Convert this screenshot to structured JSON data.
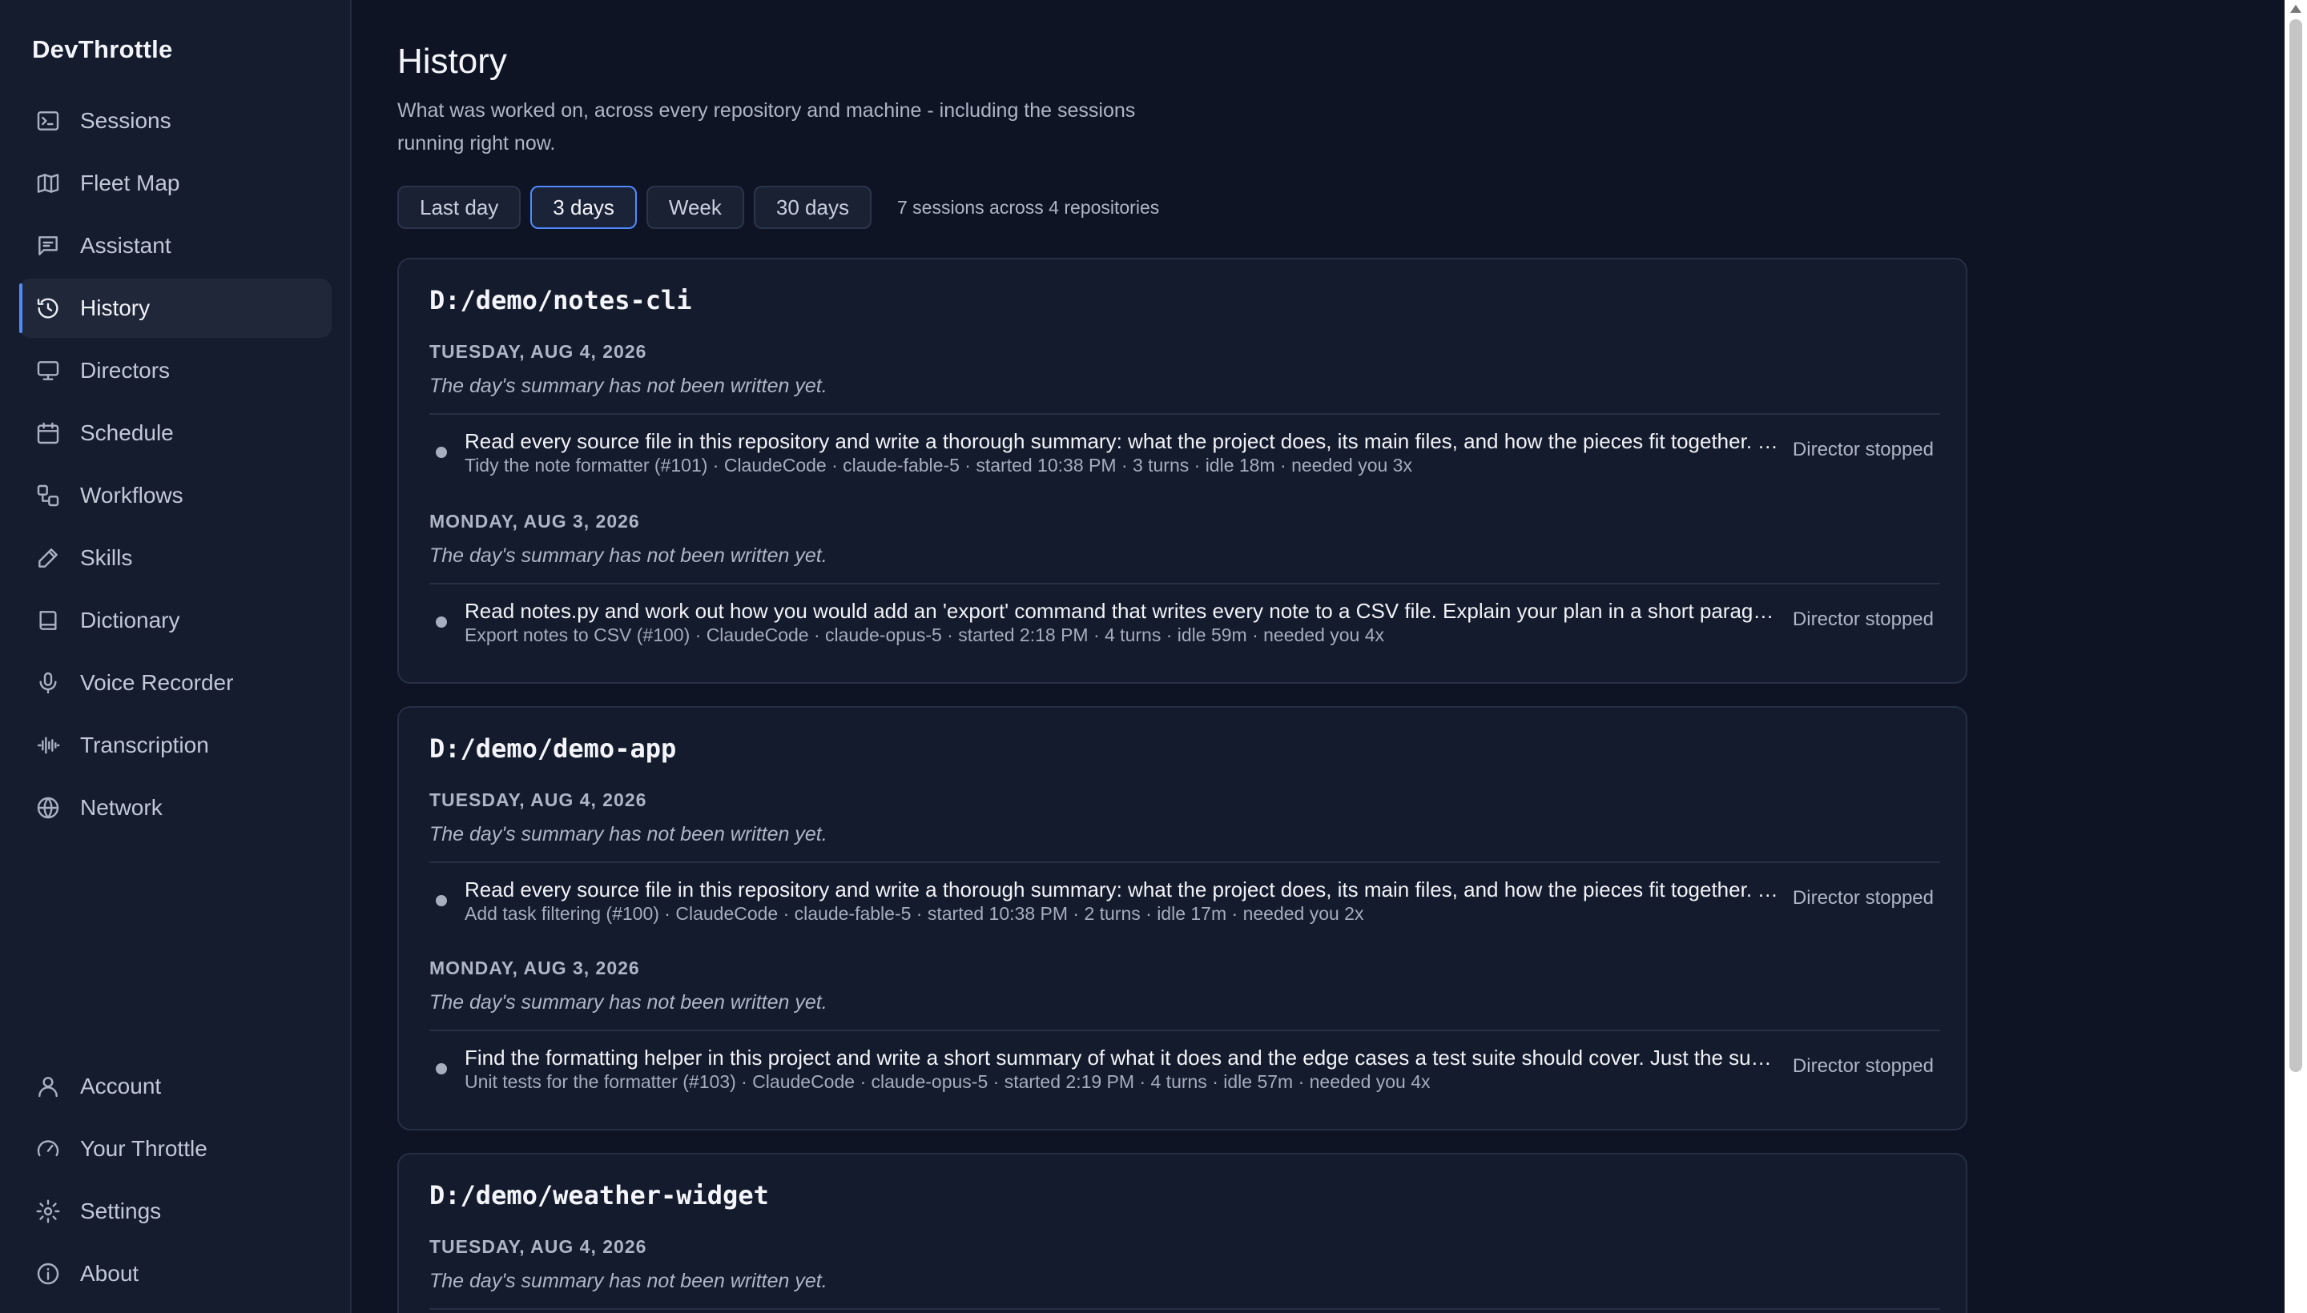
{
  "app": {
    "name": "DevThrottle"
  },
  "sidebar": {
    "items": [
      {
        "label": "Sessions",
        "icon": "terminal-icon"
      },
      {
        "label": "Fleet Map",
        "icon": "map-icon"
      },
      {
        "label": "Assistant",
        "icon": "chat-icon"
      },
      {
        "label": "History",
        "icon": "history-icon",
        "active": true
      },
      {
        "label": "Directors",
        "icon": "monitor-icon"
      },
      {
        "label": "Schedule",
        "icon": "calendar-icon"
      },
      {
        "label": "Workflows",
        "icon": "workflow-icon"
      },
      {
        "label": "Skills",
        "icon": "pen-icon"
      },
      {
        "label": "Dictionary",
        "icon": "book-icon"
      },
      {
        "label": "Voice Recorder",
        "icon": "microphone-icon"
      },
      {
        "label": "Transcription",
        "icon": "audio-waveform-icon"
      },
      {
        "label": "Network",
        "icon": "globe-icon"
      }
    ],
    "bottom_items": [
      {
        "label": "Account",
        "icon": "user-icon"
      },
      {
        "label": "Your Throttle",
        "icon": "gauge-icon"
      },
      {
        "label": "Settings",
        "icon": "gear-icon"
      },
      {
        "label": "About",
        "icon": "info-icon"
      }
    ]
  },
  "page": {
    "title": "History",
    "subtitle": "What was worked on, across every repository and machine - including the sessions running right now."
  },
  "filters": {
    "options": [
      "Last day",
      "3 days",
      "Week",
      "30 days"
    ],
    "selected": "3 days",
    "summary": "7 sessions across 4 repositories"
  },
  "repos": [
    {
      "path": "D:/demo/notes-cli",
      "days": [
        {
          "label": "TUESDAY, AUG 4, 2026",
          "summary": "The day's summary has not been written yet.",
          "sessions": [
            {
              "prompt": "Read every source file in this repository and write a thorough summary: what the project does, its main files, and how the pieces fit together. Then suggest improvements.",
              "meta": "Tidy the note formatter (#101) · ClaudeCode · claude-fable-5 · started 10:38 PM · 3 turns · idle 18m · needed you 3x",
              "status": "Director stopped"
            }
          ]
        },
        {
          "label": "MONDAY, AUG 3, 2026",
          "summary": "The day's summary has not been written yet.",
          "sessions": [
            {
              "prompt": "Read notes.py and work out how you would add an 'export' command that writes every note to a CSV file. Explain your plan in a short paragraph.",
              "meta": "Export notes to CSV (#100) · ClaudeCode · claude-opus-5 · started 2:18 PM · 4 turns · idle 59m · needed you 4x",
              "status": "Director stopped"
            }
          ]
        }
      ]
    },
    {
      "path": "D:/demo/demo-app",
      "days": [
        {
          "label": "TUESDAY, AUG 4, 2026",
          "summary": "The day's summary has not been written yet.",
          "sessions": [
            {
              "prompt": "Read every source file in this repository and write a thorough summary: what the project does, its main files, and how the pieces fit together. Then suggest improvements.",
              "meta": "Add task filtering (#100) · ClaudeCode · claude-fable-5 · started 10:38 PM · 2 turns · idle 17m · needed you 2x",
              "status": "Director stopped"
            }
          ]
        },
        {
          "label": "MONDAY, AUG 3, 2026",
          "summary": "The day's summary has not been written yet.",
          "sessions": [
            {
              "prompt": "Find the formatting helper in this project and write a short summary of what it does and the edge cases a test suite should cover. Just the summary, no code.",
              "meta": "Unit tests for the formatter (#103) · ClaudeCode · claude-opus-5 · started 2:19 PM · 4 turns · idle 57m · needed you 4x",
              "status": "Director stopped"
            }
          ]
        }
      ]
    },
    {
      "path": "D:/demo/weather-widget",
      "days": [
        {
          "label": "TUESDAY, AUG 4, 2026",
          "summary": "The day's summary has not been written yet.",
          "sessions": []
        }
      ]
    }
  ]
}
